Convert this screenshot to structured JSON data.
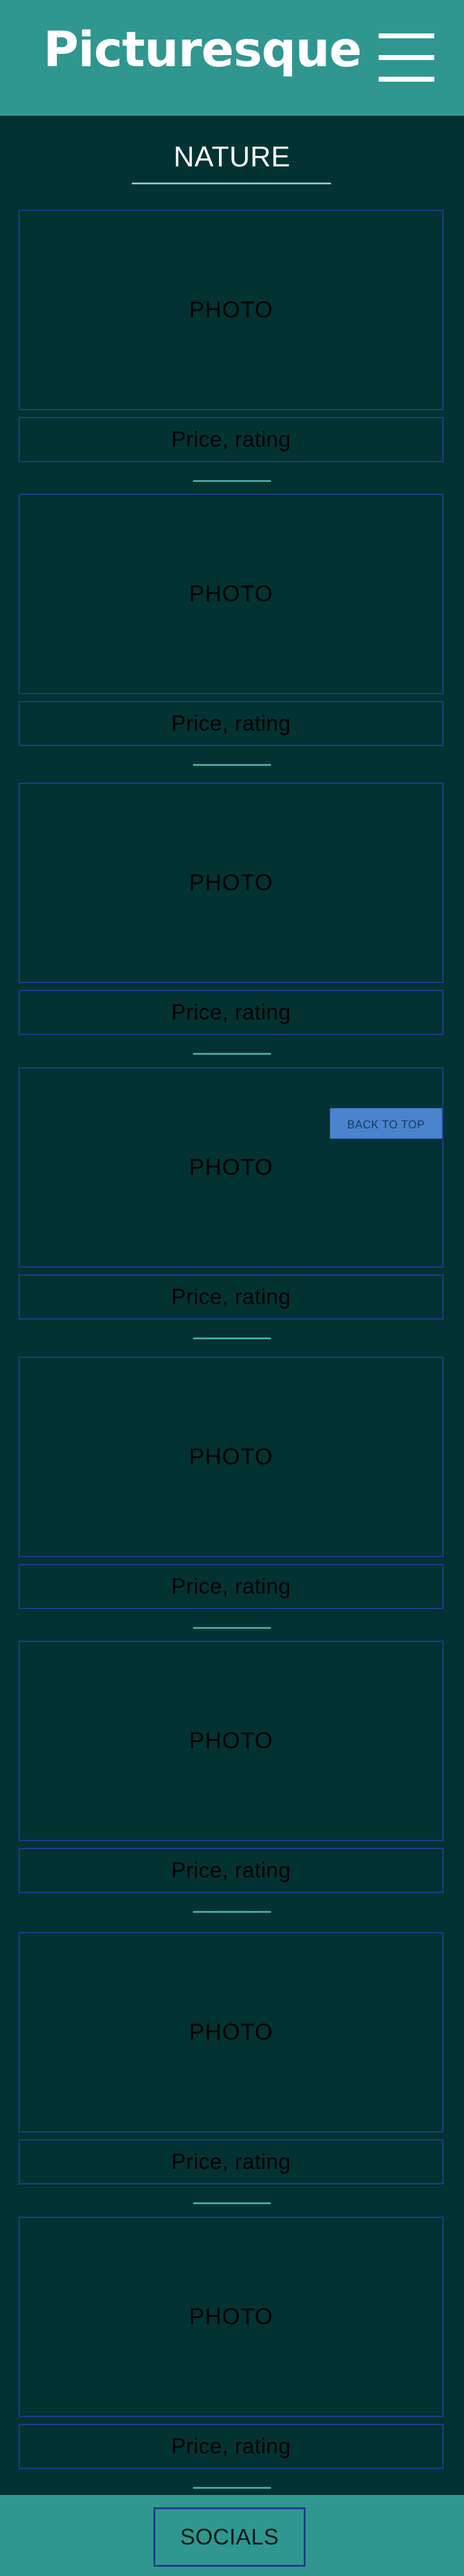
{
  "header": {
    "brand": "Picturesque"
  },
  "section": {
    "title": "NATURE"
  },
  "gallery": {
    "items": [
      {
        "photo_label": "PHOTO",
        "details_label": "Price, rating"
      },
      {
        "photo_label": "PHOTO",
        "details_label": "Price, rating"
      },
      {
        "photo_label": "PHOTO",
        "details_label": "Price, rating"
      },
      {
        "photo_label": "PHOTO",
        "details_label": "Price, rating"
      },
      {
        "photo_label": "PHOTO",
        "details_label": "Price, rating"
      },
      {
        "photo_label": "PHOTO",
        "details_label": "Price, rating"
      },
      {
        "photo_label": "PHOTO",
        "details_label": "Price, rating"
      },
      {
        "photo_label": "PHOTO",
        "details_label": "Price, rating"
      }
    ]
  },
  "back_to_top": {
    "label": "BACK TO TOP"
  },
  "footer": {
    "socials_label": "SOCIALS"
  },
  "colors": {
    "background": "#023232",
    "header": "#2f9790",
    "card_border": "#1f3c8a",
    "button": "#4a84cf"
  }
}
